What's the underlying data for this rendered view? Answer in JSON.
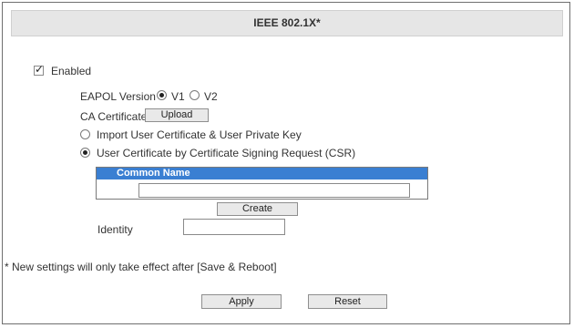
{
  "header": {
    "title": "IEEE 802.1X*"
  },
  "enabled": {
    "label": "Enabled",
    "checked": true
  },
  "eapol": {
    "label": "EAPOL Version",
    "options": [
      "V1",
      "V2"
    ],
    "selected": "V1"
  },
  "ca_certificate": {
    "label": "CA Certificate",
    "upload_label": "Upload"
  },
  "cert_mode": {
    "options": [
      "Import User Certificate & User Private Key",
      "User Certificate by Certificate Signing Request (CSR)"
    ],
    "selected_index": 1
  },
  "csr_table": {
    "header": "Common Name",
    "value": ""
  },
  "create_label": "Create",
  "identity": {
    "label": "Identity",
    "value": ""
  },
  "note": "* New settings will only take effect after [Save & Reboot]",
  "buttons": {
    "apply": "Apply",
    "reset": "Reset"
  },
  "colors": {
    "table_header_bg": "#3a7fd2",
    "title_bg": "#e6e6e6"
  }
}
